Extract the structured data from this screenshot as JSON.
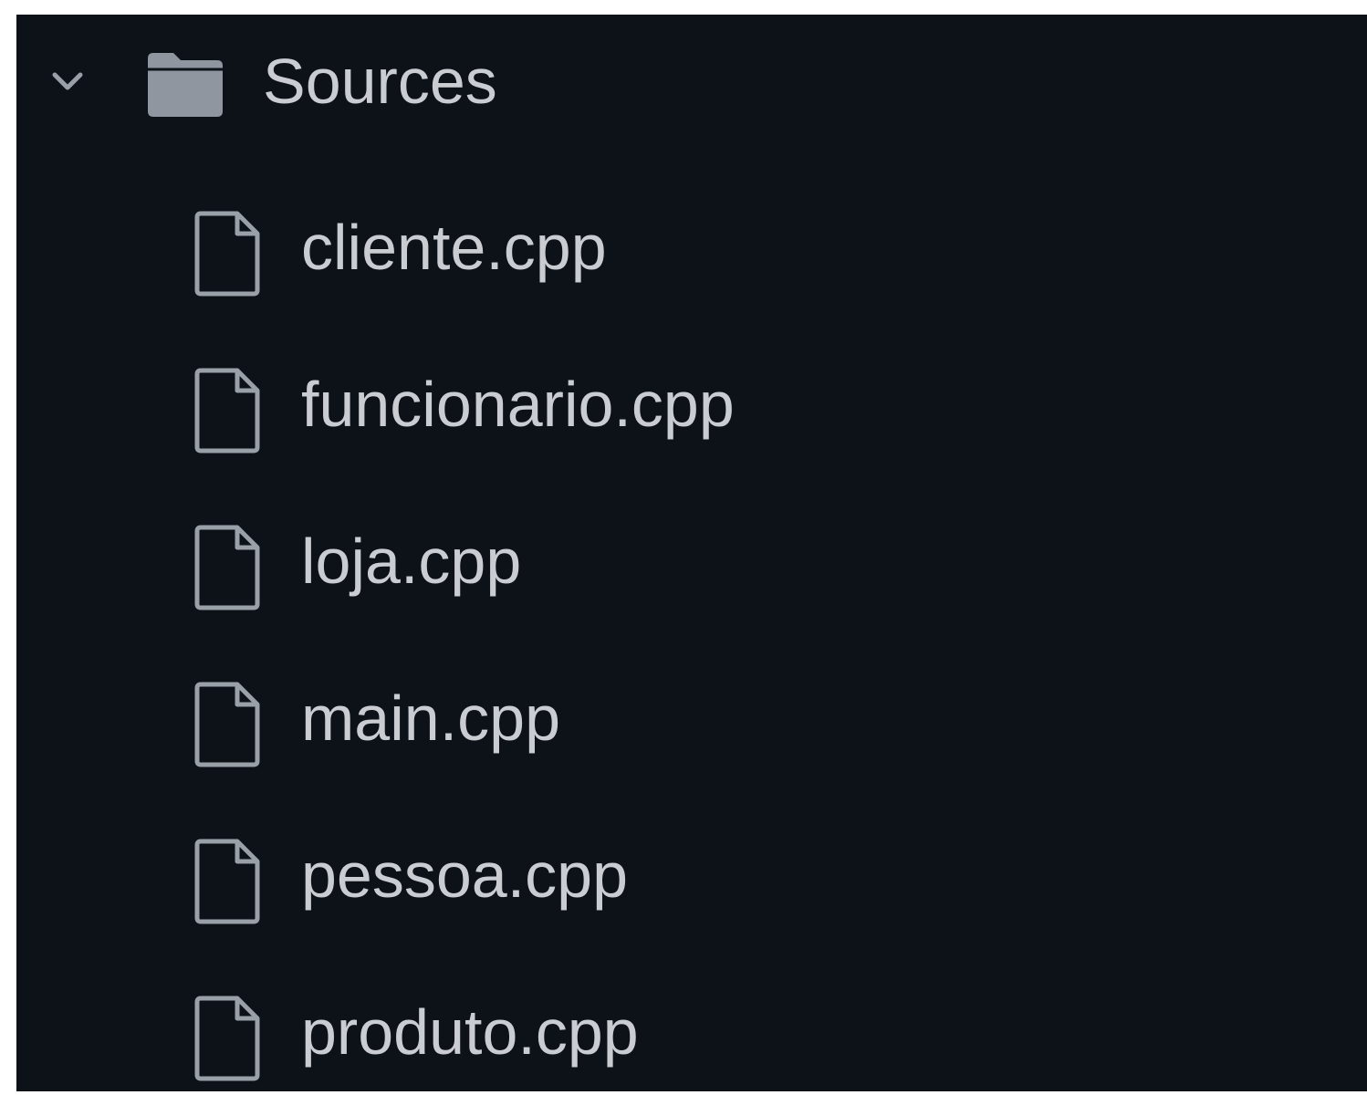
{
  "explorer": {
    "folder": {
      "label": "Sources",
      "expanded": true,
      "chevron_icon": "chevron-down-icon",
      "icon": "folder-icon"
    },
    "files": [
      {
        "label": "cliente.cpp",
        "icon": "file-icon"
      },
      {
        "label": "funcionario.cpp",
        "icon": "file-icon"
      },
      {
        "label": "loja.cpp",
        "icon": "file-icon"
      },
      {
        "label": "main.cpp",
        "icon": "file-icon"
      },
      {
        "label": "pessoa.cpp",
        "icon": "file-icon"
      },
      {
        "label": "produto.cpp",
        "icon": "file-icon"
      }
    ]
  },
  "colors": {
    "background": "#0d1118",
    "text": "#c9ccd1",
    "icon": "#9aa0a8"
  }
}
